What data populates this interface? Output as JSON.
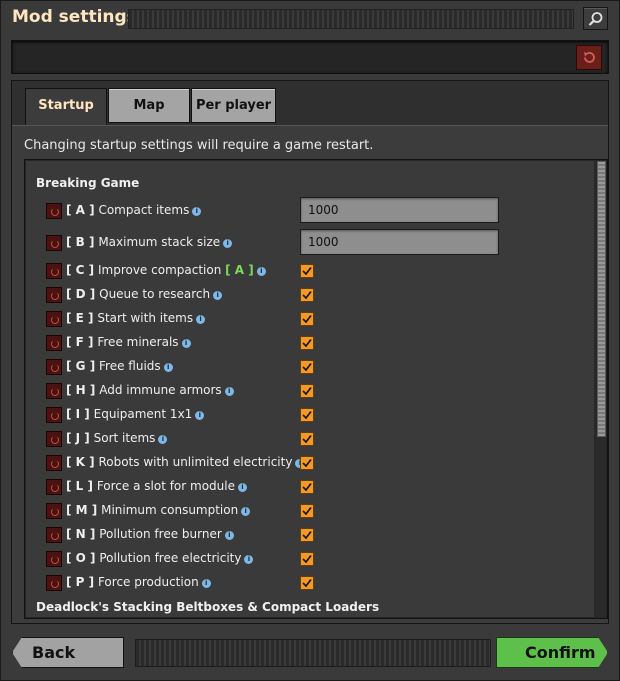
{
  "window": {
    "title": "Mod settings"
  },
  "tabs": [
    {
      "label": "Startup",
      "active": true
    },
    {
      "label": "Map",
      "active": false
    },
    {
      "label": "Per player",
      "active": false
    }
  ],
  "notice": "Changing startup settings will require a game restart.",
  "sections": [
    {
      "title": "Breaking Game",
      "settings": [
        {
          "code": "[ A ]",
          "label": "Compact items",
          "type": "text",
          "value": "1000"
        },
        {
          "code": "[ B ]",
          "label": "Maximum stack size",
          "type": "text",
          "value": "1000"
        },
        {
          "code": "[ C ]",
          "label": "Improve compaction",
          "tag": "[ A ]",
          "type": "checkbox",
          "checked": true
        },
        {
          "code": "[ D ]",
          "label": "Queue to research",
          "type": "checkbox",
          "checked": true
        },
        {
          "code": "[ E ]",
          "label": "Start with items",
          "type": "checkbox",
          "checked": true
        },
        {
          "code": "[ F ]",
          "label": "Free minerals",
          "type": "checkbox",
          "checked": true
        },
        {
          "code": "[ G ]",
          "label": "Free fluids",
          "type": "checkbox",
          "checked": true
        },
        {
          "code": "[ H ]",
          "label": "Add immune armors",
          "type": "checkbox",
          "checked": true
        },
        {
          "code": "[ I ]",
          "label": "Equipament 1x1",
          "type": "checkbox",
          "checked": true
        },
        {
          "code": "[ J ]",
          "label": "Sort items",
          "type": "checkbox",
          "checked": true
        },
        {
          "code": "[ K ]",
          "label": "Robots with unlimited electricity",
          "type": "checkbox",
          "checked": true
        },
        {
          "code": "[ L ]",
          "label": "Force a slot for module",
          "type": "checkbox",
          "checked": true
        },
        {
          "code": "[ M ]",
          "label": "Minimum consumption",
          "type": "checkbox",
          "checked": true
        },
        {
          "code": "[ N ]",
          "label": "Pollution free burner",
          "type": "checkbox",
          "checked": true
        },
        {
          "code": "[ O ]",
          "label": "Pollution free electricity",
          "type": "checkbox",
          "checked": true
        },
        {
          "code": "[ P ]",
          "label": "Force production",
          "type": "checkbox",
          "checked": true
        }
      ]
    },
    {
      "title": "Deadlock's Stacking Beltboxes & Compact Loaders",
      "settings": []
    }
  ],
  "footer": {
    "back_label": "Back",
    "confirm_label": "Confirm"
  },
  "colors": {
    "accent_orange": "#f09a2a",
    "confirm_green": "#5dc04a",
    "title_cream": "#ffe6c0",
    "tag_green": "#7fd85a",
    "info_blue": "#7fb7e6"
  },
  "icons": {
    "search": "search-icon",
    "reset": "reset-icon",
    "info": "info-icon",
    "check": "checkmark-icon"
  }
}
